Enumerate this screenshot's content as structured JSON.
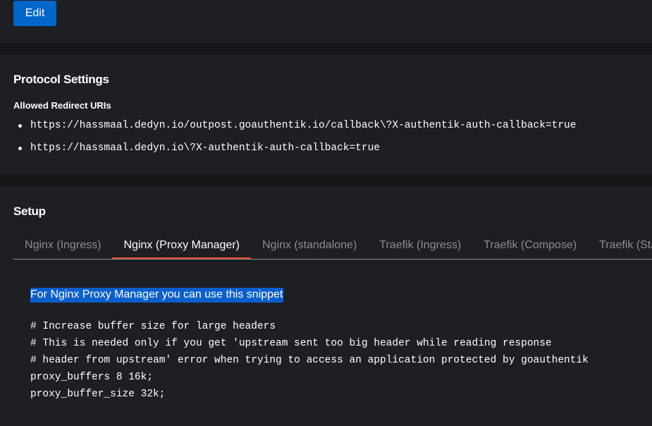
{
  "top": {
    "edit_label": "Edit"
  },
  "protocol": {
    "title": "Protocol Settings",
    "redirect_label": "Allowed Redirect URIs",
    "redirect_uris": [
      "https://hassmaal.dedyn.io/outpost.goauthentik.io/callback\\?X-authentik-auth-callback=true",
      "https://hassmaal.dedyn.io\\?X-authentik-auth-callback=true"
    ]
  },
  "setup": {
    "title": "Setup",
    "tabs": [
      {
        "label": "Nginx (Ingress)",
        "active": false
      },
      {
        "label": "Nginx (Proxy Manager)",
        "active": true
      },
      {
        "label": "Nginx (standalone)",
        "active": false
      },
      {
        "label": "Traefik (Ingress)",
        "active": false
      },
      {
        "label": "Traefik (Compose)",
        "active": false
      },
      {
        "label": "Traefik (Standalone)",
        "active": false
      }
    ],
    "intro": "For Nginx Proxy Manager you can use this snippet",
    "code_lines": [
      "# Increase buffer size for large headers",
      "# This is needed only if you get 'upstream sent too big header while reading response",
      "# header from upstream' error when trying to access an application protected by goauthentik",
      "proxy_buffers 8 16k;",
      "proxy_buffer_size 32k;"
    ]
  },
  "colors": {
    "page_bg": "#151618",
    "card_bg": "#1e1f23",
    "primary_button": "#0066cc",
    "tab_active_underline": "#ee4c2c",
    "selection_highlight": "#0a5fcc",
    "muted_text": "#8a8d90"
  }
}
